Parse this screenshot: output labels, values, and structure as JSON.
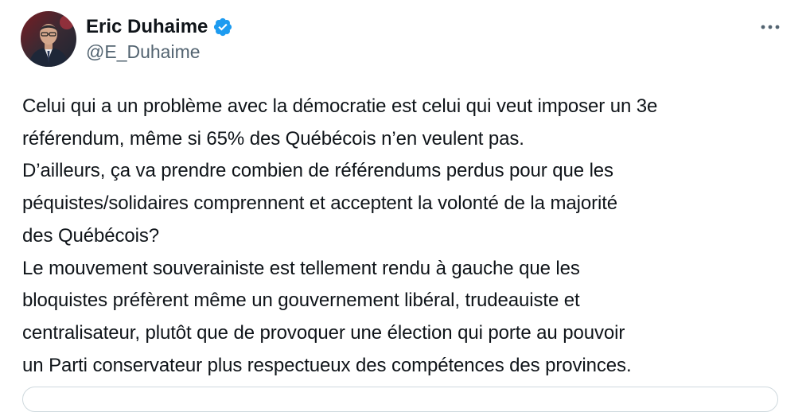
{
  "author": {
    "display_name": "Eric Duhaime",
    "handle": "@E_Duhaime",
    "verified": true
  },
  "tweet": {
    "lines": [
      "Celui qui a un problème avec la démocratie est celui qui veut imposer un 3e",
      "référendum, même si 65% des Québécois n’en veulent pas.",
      "D’ailleurs, ça va prendre combien de référendums perdus pour que les",
      "péquistes/solidaires comprennent et acceptent la volonté de la majorité",
      "des Québécois?",
      "Le mouvement souverainiste est tellement rendu à gauche que les",
      "bloquistes préfèrent même un gouvernement libéral, trudeauiste et",
      "centralisateur, plutôt que de provoquer une élection qui porte au pouvoir",
      "un Parti conservateur plus respectueux des compétences des provinces."
    ]
  },
  "icons": {
    "verified": "verified-badge-icon",
    "more": "more-options-icon"
  },
  "colors": {
    "text": "#0f1419",
    "secondary": "#536471",
    "verified_blue": "#1d9bf0",
    "border": "#cfd9de"
  }
}
